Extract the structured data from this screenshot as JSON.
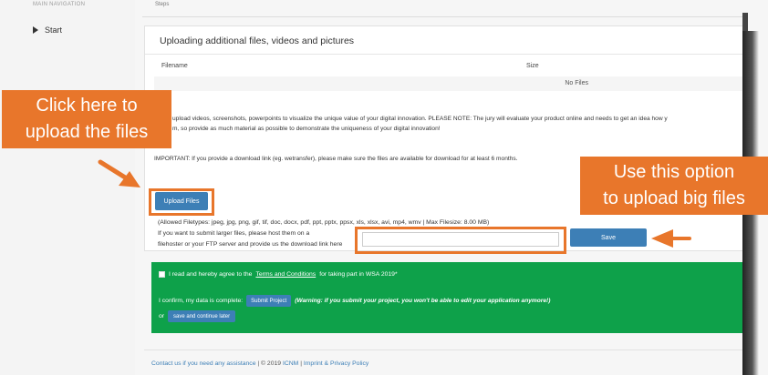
{
  "sidebar": {
    "title": "MAIN NAVIGATION",
    "items": [
      {
        "label": "Start"
      }
    ]
  },
  "breadcrumb": "Steps",
  "upload_card": {
    "title": "Uploading additional files, videos and pictures",
    "table": {
      "columns": [
        "Filename",
        "Size"
      ],
      "empty_text": "No Files"
    },
    "description_line1": "upload videos, screenshots, powerpoints to visualize the unique value of your digital innovation. PLEASE NOTE: The jury will evaluate your product online and needs to get an idea how y",
    "description_line2": "m, so provide as much material as possible to demonstrate the uniqueness of your digital innovation!",
    "important": "IMPORTANT: If you provide a download link (eg. wetransfer), please make sure the files are available for download for at least 6 months.",
    "upload_button": "Upload Files",
    "allowed_filetypes": "(Allowed Filetypes: jpeg, jpg, png, gif, tif, doc, docx, pdf, ppt, pptx, ppsx, xls, xlsx, avi, mp4, wmv | Max Filesize: 8.00 MB)",
    "larger_files_line1": "If you want to submit larger files, please host them on a",
    "larger_files_line2": "filehoster or your FTP server and provide us the download link here",
    "link_input_value": "",
    "link_input_placeholder": "",
    "save_button": "Save"
  },
  "submit_section": {
    "agree_prefix": "I read and hereby agree to the",
    "terms_link": "Terms and Conditions",
    "agree_suffix": "for taking part in WSA 2019*",
    "confirm_text": "I confirm, my data is complete:",
    "submit_button": "Submit Project",
    "warning": "(Warning: if you submit your project, you won't be able to edit your application anymore!)",
    "or_text": "or",
    "continue_button": "save and continue later"
  },
  "footer": {
    "contact_link": "Contact us if you need any assistance",
    "separator1": "|",
    "copyright": "© 2019",
    "icnm_link": "ICNM",
    "separator2": "|",
    "imprint_link": "Imprint & Privacy Policy"
  },
  "callouts": {
    "left_line1": "Click here to",
    "left_line2": "upload the files",
    "right_line1": "Use this option",
    "right_line2": "to upload big files"
  },
  "colors": {
    "callout_orange": "#e8762b",
    "button_blue": "#3d7fb6",
    "submit_green": "#0ea14a"
  }
}
